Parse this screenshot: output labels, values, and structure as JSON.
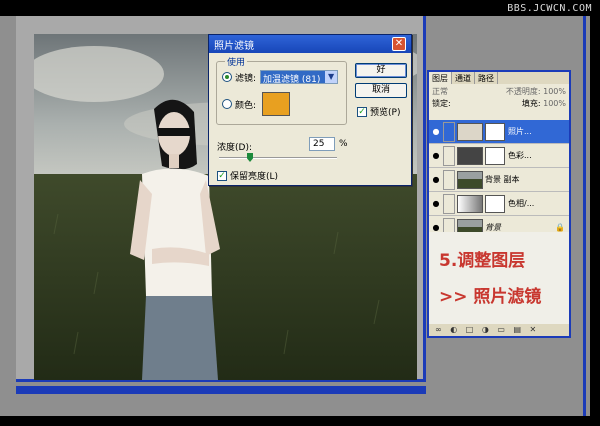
{
  "watermark": "BBS.JCWCN.COM",
  "dialog": {
    "title": "照片滤镜",
    "close": "✕",
    "group_label": "使用",
    "filter_label": "滤镜:",
    "filter_value": "加温滤镜 (81)",
    "color_label": "颜色:",
    "color_swatch": "#e8a020",
    "ok": "好",
    "cancel": "取消",
    "preview": "预览(P)",
    "density_label": "浓度(D):",
    "density_value": "25",
    "density_unit": "%",
    "density_fraction": 0.25,
    "keep_luminosity": "保留亮度(L)"
  },
  "layers_panel": {
    "tabs": [
      "图层",
      "通道",
      "路径"
    ],
    "blend_mode": "正常",
    "opacity_label": "不透明度:",
    "opacity_value": "100%",
    "lock_label": "锁定:",
    "fill_label": "填充:",
    "fill_value": "100%",
    "layers": [
      {
        "name": "照片...",
        "selected": true
      },
      {
        "name": "色彩...",
        "selected": false
      },
      {
        "name": "背景 副本",
        "selected": false
      },
      {
        "name": "色相/...",
        "selected": false
      },
      {
        "name": "背景",
        "selected": false
      }
    ],
    "annotation_line1": "5.调整图层",
    "annotation_line2": ">> 照片滤镜",
    "footer_icons": "∞ ◐ □ ◑ ▭ ▤ ✕"
  },
  "colors": {
    "accent_blue": "#1b3bb8",
    "annotation_red": "#c8372f"
  }
}
